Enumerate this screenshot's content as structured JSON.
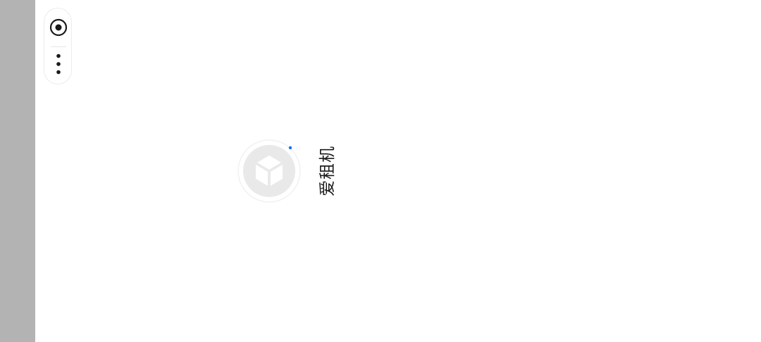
{
  "app": {
    "name": "爱租机"
  },
  "capsule": {
    "record_icon": "record-icon",
    "more_icon": "more-vertical-icon"
  },
  "loader": {
    "logo_icon": "app-logo-placeholder-icon",
    "spinner_color": "#1a6ef5"
  },
  "colors": {
    "side_strip": "#b3b3b3",
    "icon": "#1a1a1a"
  }
}
